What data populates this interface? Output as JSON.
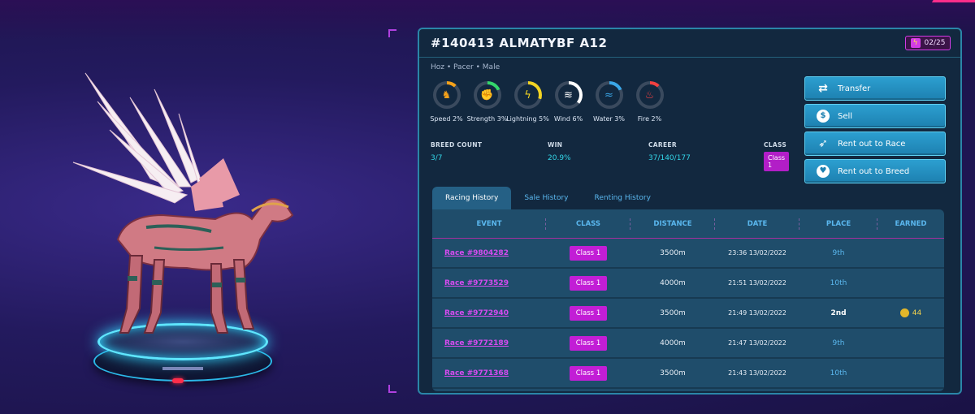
{
  "horse": {
    "title": "#140413 ALMATYBF A12",
    "energy": "02/25",
    "meta": "Hoz • Pacer • Male"
  },
  "stats": [
    {
      "label": "Speed 2%",
      "icon": "horse-icon",
      "glyph": "♞",
      "color": "#f5a11a",
      "value": 0.02
    },
    {
      "label": "Strength 3%",
      "icon": "fist-icon",
      "glyph": "✊",
      "color": "#33d66b",
      "value": 0.03
    },
    {
      "label": "Lightning 5%",
      "icon": "lightning-icon",
      "glyph": "ϟ",
      "color": "#f2d323",
      "value": 0.05
    },
    {
      "label": "Wind 6%",
      "icon": "wind-icon",
      "glyph": "≋",
      "color": "#ffffff",
      "value": 0.06
    },
    {
      "label": "Water 3%",
      "icon": "water-icon",
      "glyph": "≈",
      "color": "#3aa7e8",
      "value": 0.03
    },
    {
      "label": "Fire 2%",
      "icon": "fire-icon",
      "glyph": "♨",
      "color": "#f24141",
      "value": 0.02
    }
  ],
  "info": {
    "breed_label": "BREED COUNT",
    "breed_value": "3/7",
    "win_label": "WIN",
    "win_value": "20.9%",
    "career_label": "CAREER",
    "career_value": "37/140/177",
    "class_label": "CLASS",
    "class_value": "Class 1"
  },
  "actions": [
    {
      "label": "Transfer",
      "icon": "transfer-icon",
      "glyph": "⇄"
    },
    {
      "label": "Sell",
      "icon": "dollar-icon",
      "glyph": "$"
    },
    {
      "label": "Rent out to Race",
      "icon": "race-icon",
      "glyph": "➶"
    },
    {
      "label": "Rent out to Breed",
      "icon": "heart-icon",
      "glyph": "♥"
    }
  ],
  "tabs": [
    "Racing History",
    "Sale History",
    "Renting History"
  ],
  "table": {
    "headers": [
      "EVENT",
      "CLASS",
      "DISTANCE",
      "DATE",
      "PLACE",
      "EARNED"
    ],
    "rows": [
      {
        "event": "Race #9804282",
        "class": "Class 1",
        "distance": "3500m",
        "date": "23:36 13/02/2022",
        "place": "9th",
        "earned": ""
      },
      {
        "event": "Race #9773529",
        "class": "Class 1",
        "distance": "4000m",
        "date": "21:51 13/02/2022",
        "place": "10th",
        "earned": ""
      },
      {
        "event": "Race #9772940",
        "class": "Class 1",
        "distance": "3500m",
        "date": "21:49 13/02/2022",
        "place": "2nd",
        "earned": "44"
      },
      {
        "event": "Race #9772189",
        "class": "Class 1",
        "distance": "4000m",
        "date": "21:47 13/02/2022",
        "place": "9th",
        "earned": ""
      },
      {
        "event": "Race #9771368",
        "class": "Class 1",
        "distance": "3500m",
        "date": "21:43 13/02/2022",
        "place": "10th",
        "earned": ""
      }
    ]
  }
}
